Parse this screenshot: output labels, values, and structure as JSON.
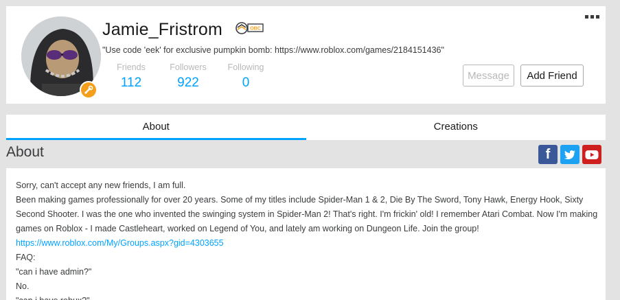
{
  "profile": {
    "username": "Jamie_Fristrom",
    "badge_text": "OBC",
    "status": "\"Use code 'eek' for exclusive pumpkin bomb: https://www.roblox.com/games/2184151436\"",
    "stats": [
      {
        "label": "Friends",
        "count": "112"
      },
      {
        "label": "Followers",
        "count": "922"
      },
      {
        "label": "Following",
        "count": "0"
      }
    ],
    "buttons": {
      "message": "Message",
      "add_friend": "Add Friend"
    }
  },
  "tabs": [
    {
      "label": "About",
      "active": true
    },
    {
      "label": "Creations",
      "active": false
    }
  ],
  "about": {
    "title": "About",
    "social_icons": [
      "facebook-icon",
      "twitter-icon",
      "youtube-icon"
    ],
    "lines": [
      "Sorry, can't accept any new friends, I am full.",
      "Been making games professionally for over 20 years.  Some of my titles include Spider-Man 1 & 2, Die By The Sword, Tony Hawk, Energy Hook, Sixty Second Shooter. I was the one who invented the swinging system in Spider-Man 2! That's right. I'm frickin' old! I remember Atari Combat. Now I'm making games on Roblox - I made Castleheart, worked on Legend of You, and lately am working on Dungeon Life. Join the group!",
      "https://www.roblox.com/My/Groups.aspx?gid=4303655",
      "FAQ:",
      "\"can i have admin?\"",
      "No.",
      "\"can i have robux?\""
    ]
  },
  "colors": {
    "accent": "#00a2ff",
    "builders_club": "#f49f1c"
  }
}
